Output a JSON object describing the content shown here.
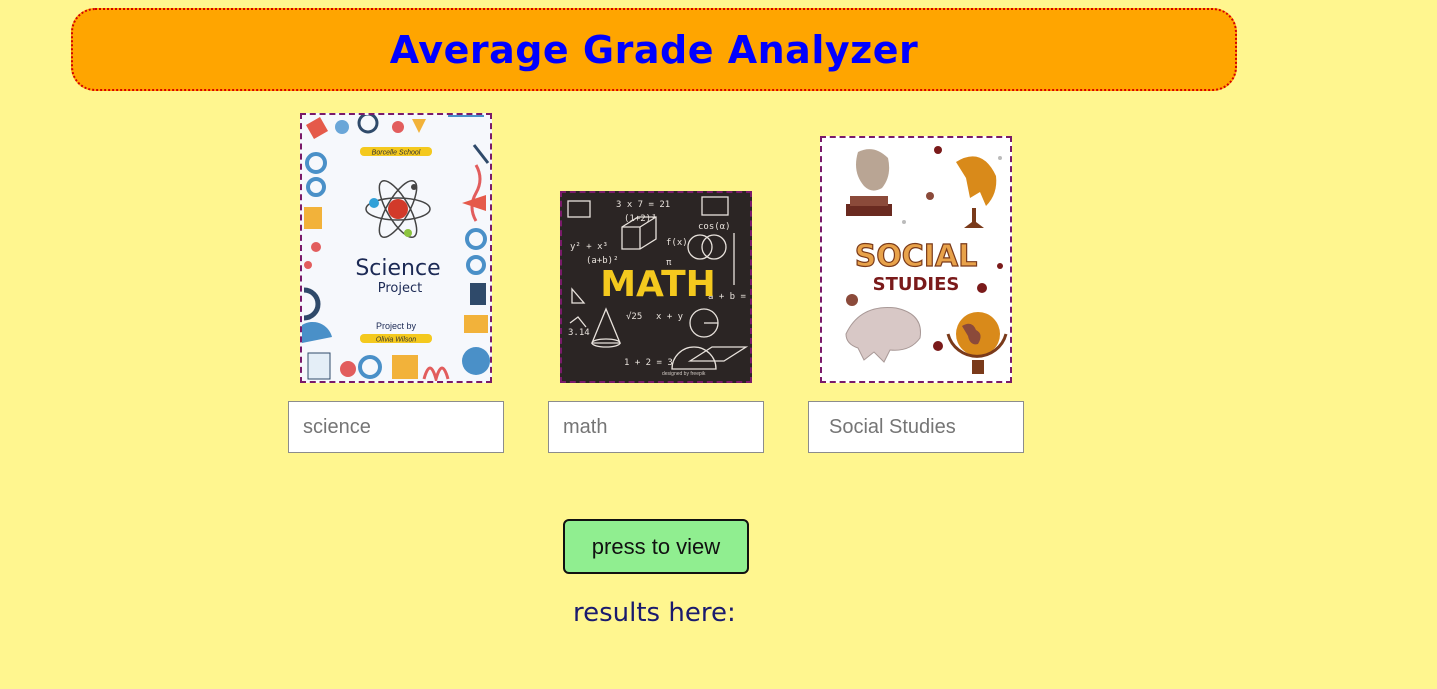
{
  "header": {
    "title": "Average Grade Analyzer"
  },
  "cards": {
    "science": {
      "school": "Borcelle School",
      "title_line1": "Science",
      "title_line2": "Project",
      "by_label": "Project by",
      "author": "Olivia Wilson"
    },
    "math": {
      "title": "MATH",
      "credit": "designed by freepik",
      "formulas": [
        "3 x 7 = 21",
        "(1+2)³",
        "y² + x³",
        "(a+b)²",
        "3.14",
        "√25",
        "x + y",
        "1 + 2 = 3",
        "cos(α)",
        "a + b = c",
        "π",
        "f(x)"
      ]
    },
    "social": {
      "title_line1": "SOCIAL",
      "title_line2": "STUDIES"
    }
  },
  "inputs": {
    "science_placeholder": "science",
    "math_placeholder": "math",
    "social_placeholder": "Social Studies"
  },
  "button": {
    "label": "press to view"
  },
  "results": {
    "label": "results here:"
  },
  "colors": {
    "background": "#fff68f",
    "header_bg": "#ffa500",
    "header_border": "#d40000",
    "title": "#0000ff",
    "button_bg": "#90ee90",
    "results_text": "#1a1a6e"
  }
}
